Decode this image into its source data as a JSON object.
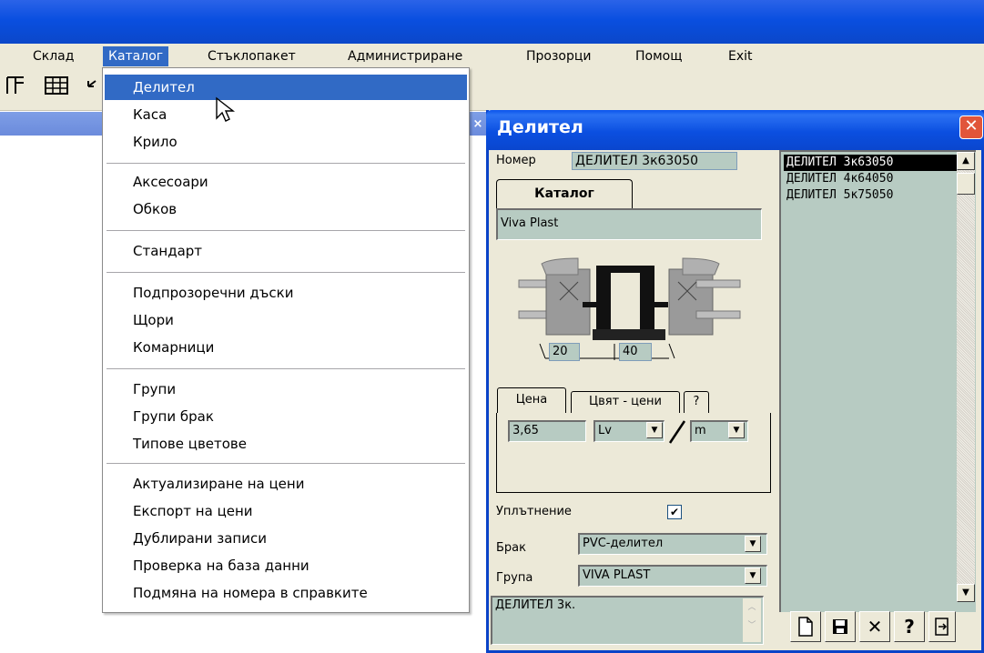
{
  "menubar": {
    "items": [
      "Склад",
      "Каталог",
      "Стъклопакет",
      "Администриране",
      "Прозорци",
      "Помощ",
      "Exit"
    ]
  },
  "dropdown": {
    "items": [
      "Делител",
      "Каса",
      "Крило",
      "Аксесоари",
      "Обков",
      "Стандарт",
      "Подпрозоречни дъски",
      "Щори",
      "Комарници",
      "Групи",
      "Групи брак",
      "Типове цветове",
      "Актуализиране на цени",
      "Експорт на цени",
      "Дублирани записи",
      "Проверка на база данни",
      "Подмяна на номера в справките"
    ]
  },
  "window": {
    "title": "Делител",
    "close_icon": "close-icon",
    "number_label": "Номер",
    "number_value": "ДЕЛИТЕЛ 3к63050",
    "catalog_tab": "Каталог",
    "catalog_value": "Viva Plast",
    "dim_left": "20",
    "dim_right": "40",
    "tabs": [
      "Цена",
      "Цвят - цени",
      "?"
    ],
    "price_value": "3,65",
    "currency": "Lv",
    "unit": "m",
    "seal_label": "Уплътнение",
    "seal_checked": "✔",
    "brak_label": "Брак",
    "brak_value": "PVC-делител",
    "group_label": "Група",
    "group_value": "VIVA PLAST",
    "note_value": "ДЕЛИТЕЛ 3к.",
    "list": [
      "ДЕЛИТЕЛ 3к63050",
      "ДЕЛИТЕЛ 4к64050",
      "ДЕЛИТЕЛ 5к75050"
    ]
  }
}
